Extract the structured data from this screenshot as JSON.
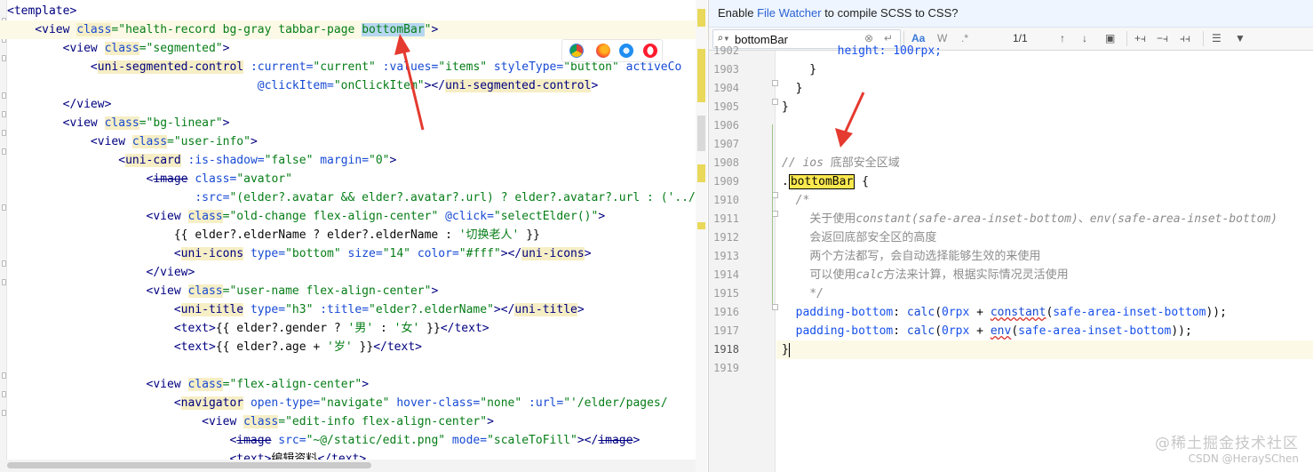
{
  "left_editor": {
    "lines": [
      {
        "segments": [
          {
            "t": "<template>",
            "c": "t-tag"
          }
        ]
      },
      {
        "segments": [
          {
            "t": "    <view ",
            "c": "t-tag"
          },
          {
            "t": "class",
            "c": "t-attr t-hl"
          },
          {
            "t": "=\"health-record bg-gray tabbar-page ",
            "c": "t-str"
          },
          {
            "t": "bottomBar",
            "c": "t-str t-sel"
          },
          {
            "t": "\"",
            "c": "t-str"
          },
          {
            "t": ">",
            "c": "t-tag"
          }
        ],
        "current": true
      },
      {
        "segments": [
          {
            "t": "        <view ",
            "c": "t-tag"
          },
          {
            "t": "class",
            "c": "t-attr t-hl"
          },
          {
            "t": "=\"segmented\"",
            "c": "t-str"
          },
          {
            "t": ">",
            "c": "t-tag"
          }
        ]
      },
      {
        "segments": [
          {
            "t": "            <",
            "c": "t-tag"
          },
          {
            "t": "uni-segmented-control",
            "c": "t-tag t-hl"
          },
          {
            "t": " :current=",
            "c": "t-attr"
          },
          {
            "t": "\"current\"",
            "c": "t-str"
          },
          {
            "t": " :values=",
            "c": "t-attr"
          },
          {
            "t": "\"items\"",
            "c": "t-str"
          },
          {
            "t": " styleType=",
            "c": "t-attr"
          },
          {
            "t": "\"button\"",
            "c": "t-str"
          },
          {
            "t": " activeCo",
            "c": "t-attr"
          }
        ]
      },
      {
        "segments": [
          {
            "t": "                                    @clickItem=",
            "c": "t-attr"
          },
          {
            "t": "\"onClickItem\"",
            "c": "t-str"
          },
          {
            "t": "></",
            "c": "t-tag"
          },
          {
            "t": "uni-segmented-control",
            "c": "t-tag t-hl"
          },
          {
            "t": ">",
            "c": "t-tag"
          }
        ]
      },
      {
        "segments": [
          {
            "t": "        </view>",
            "c": "t-tag"
          }
        ]
      },
      {
        "segments": [
          {
            "t": "        <view ",
            "c": "t-tag"
          },
          {
            "t": "class",
            "c": "t-attr t-hl"
          },
          {
            "t": "=\"bg-linear\"",
            "c": "t-str"
          },
          {
            "t": ">",
            "c": "t-tag"
          }
        ]
      },
      {
        "segments": [
          {
            "t": "            <view ",
            "c": "t-tag"
          },
          {
            "t": "class",
            "c": "t-attr t-hl"
          },
          {
            "t": "=\"user-info\"",
            "c": "t-str"
          },
          {
            "t": ">",
            "c": "t-tag"
          }
        ]
      },
      {
        "segments": [
          {
            "t": "                <",
            "c": "t-tag"
          },
          {
            "t": "uni-card",
            "c": "t-tag t-hl"
          },
          {
            "t": " :is-shadow=",
            "c": "t-attr"
          },
          {
            "t": "\"false\"",
            "c": "t-str"
          },
          {
            "t": " margin=",
            "c": "t-attr"
          },
          {
            "t": "\"0\"",
            "c": "t-str"
          },
          {
            "t": ">",
            "c": "t-tag"
          }
        ]
      },
      {
        "segments": [
          {
            "t": "                    <",
            "c": "t-tag"
          },
          {
            "t": "image",
            "c": "t-tag t-strike"
          },
          {
            "t": " class=",
            "c": "t-attr"
          },
          {
            "t": "\"avator\"",
            "c": "t-str"
          }
        ]
      },
      {
        "segments": [
          {
            "t": "                           :src=",
            "c": "t-attr"
          },
          {
            "t": "\"(elder?.avatar && elder?.avatar?.url) ? elder?.avatar?.url : ('../",
            "c": "t-str"
          }
        ]
      },
      {
        "segments": [
          {
            "t": "                    <view ",
            "c": "t-tag"
          },
          {
            "t": "class",
            "c": "t-attr t-hl"
          },
          {
            "t": "=\"old-change flex-align-center\"",
            "c": "t-str"
          },
          {
            "t": " @click=",
            "c": "t-attr"
          },
          {
            "t": "\"selectElder()\"",
            "c": "t-str"
          },
          {
            "t": ">",
            "c": "t-tag"
          }
        ]
      },
      {
        "segments": [
          {
            "t": "                        {{ elder?.elderName ? elder?.elderName : ",
            "c": "t-text"
          },
          {
            "t": "'切换老人'",
            "c": "t-str"
          },
          {
            "t": " }}",
            "c": "t-text"
          }
        ]
      },
      {
        "segments": [
          {
            "t": "                        <",
            "c": "t-tag"
          },
          {
            "t": "uni-icons",
            "c": "t-tag t-hl"
          },
          {
            "t": " type=",
            "c": "t-attr"
          },
          {
            "t": "\"bottom\"",
            "c": "t-str"
          },
          {
            "t": " size=",
            "c": "t-attr"
          },
          {
            "t": "\"14\"",
            "c": "t-str"
          },
          {
            "t": " color=",
            "c": "t-attr"
          },
          {
            "t": "\"#fff\"",
            "c": "t-str"
          },
          {
            "t": "></",
            "c": "t-tag"
          },
          {
            "t": "uni-icons",
            "c": "t-tag t-hl"
          },
          {
            "t": ">",
            "c": "t-tag"
          }
        ]
      },
      {
        "segments": [
          {
            "t": "                    </view>",
            "c": "t-tag"
          }
        ]
      },
      {
        "segments": [
          {
            "t": "                    <view ",
            "c": "t-tag"
          },
          {
            "t": "class",
            "c": "t-attr t-hl"
          },
          {
            "t": "=\"user-name flex-align-center\"",
            "c": "t-str"
          },
          {
            "t": ">",
            "c": "t-tag"
          }
        ]
      },
      {
        "segments": [
          {
            "t": "                        <",
            "c": "t-tag"
          },
          {
            "t": "uni-title",
            "c": "t-tag t-hl"
          },
          {
            "t": " type=",
            "c": "t-attr"
          },
          {
            "t": "\"h3\"",
            "c": "t-str"
          },
          {
            "t": " :title=",
            "c": "t-attr"
          },
          {
            "t": "\"elder?.elderName\"",
            "c": "t-str"
          },
          {
            "t": "></",
            "c": "t-tag"
          },
          {
            "t": "uni-title",
            "c": "t-tag t-hl"
          },
          {
            "t": ">",
            "c": "t-tag"
          }
        ]
      },
      {
        "segments": [
          {
            "t": "                        <text>",
            "c": "t-tag"
          },
          {
            "t": "{{ elder?.gender ? ",
            "c": "t-text"
          },
          {
            "t": "'男'",
            "c": "t-str"
          },
          {
            "t": " : ",
            "c": "t-text"
          },
          {
            "t": "'女'",
            "c": "t-str"
          },
          {
            "t": " }}",
            "c": "t-text"
          },
          {
            "t": "</text>",
            "c": "t-tag"
          }
        ]
      },
      {
        "segments": [
          {
            "t": "                        <text>",
            "c": "t-tag"
          },
          {
            "t": "{{ elder?.age + ",
            "c": "t-text"
          },
          {
            "t": "'岁'",
            "c": "t-str"
          },
          {
            "t": " }}",
            "c": "t-text"
          },
          {
            "t": "</text>",
            "c": "t-tag"
          }
        ]
      },
      {
        "segments": [
          {
            "t": "",
            "c": "t-text"
          }
        ]
      },
      {
        "segments": [
          {
            "t": "                    <view ",
            "c": "t-tag"
          },
          {
            "t": "class",
            "c": "t-attr t-hl"
          },
          {
            "t": "=\"flex-align-center\"",
            "c": "t-str"
          },
          {
            "t": ">",
            "c": "t-tag"
          }
        ]
      },
      {
        "segments": [
          {
            "t": "                        <",
            "c": "t-tag"
          },
          {
            "t": "navigator",
            "c": "t-tag t-hl"
          },
          {
            "t": " open-type=",
            "c": "t-attr"
          },
          {
            "t": "\"navigate\"",
            "c": "t-str"
          },
          {
            "t": " hover-class=",
            "c": "t-attr"
          },
          {
            "t": "\"none\"",
            "c": "t-str"
          },
          {
            "t": " :url=",
            "c": "t-attr"
          },
          {
            "t": "\"'/elder/pages/",
            "c": "t-str"
          }
        ]
      },
      {
        "segments": [
          {
            "t": "                            <view ",
            "c": "t-tag"
          },
          {
            "t": "class",
            "c": "t-attr t-hl"
          },
          {
            "t": "=\"edit-info flex-align-center\"",
            "c": "t-str"
          },
          {
            "t": ">",
            "c": "t-tag"
          }
        ]
      },
      {
        "segments": [
          {
            "t": "                                <",
            "c": "t-tag"
          },
          {
            "t": "image",
            "c": "t-tag t-strike"
          },
          {
            "t": " src=",
            "c": "t-attr"
          },
          {
            "t": "\"~@/static/edit.png\"",
            "c": "t-str"
          },
          {
            "t": " mode=",
            "c": "t-attr"
          },
          {
            "t": "\"scaleToFill\"",
            "c": "t-str"
          },
          {
            "t": "></",
            "c": "t-tag"
          },
          {
            "t": "image",
            "c": "t-tag t-strike"
          },
          {
            "t": ">",
            "c": "t-tag"
          }
        ]
      },
      {
        "segments": [
          {
            "t": "                                <text>",
            "c": "t-tag"
          },
          {
            "t": "编辑资料",
            "c": "t-text"
          },
          {
            "t": "</text>",
            "c": "t-tag"
          }
        ]
      }
    ]
  },
  "banner": {
    "prefix": "Enable ",
    "link": "File Watcher",
    "suffix": " to compile SCSS to CSS?"
  },
  "search": {
    "value": "bottomBar",
    "match_case": "Aa",
    "words": "W",
    "regex": ".*",
    "count": "1/1"
  },
  "right_editor": {
    "line_numbers": [
      "1902",
      "1903",
      "1904",
      "1905",
      "1906",
      "1907",
      "1908",
      "1909",
      "1910",
      "1911",
      "1912",
      "1913",
      "1914",
      "1915",
      "1916",
      "1917",
      "1918",
      "1919"
    ],
    "lines": [
      {
        "segments": [
          {
            "t": "        height: 100rpx;",
            "c": "t-prop"
          }
        ]
      },
      {
        "segments": [
          {
            "t": "    }",
            "c": "t-text"
          }
        ]
      },
      {
        "segments": [
          {
            "t": "  }",
            "c": "t-text"
          }
        ]
      },
      {
        "segments": [
          {
            "t": "}",
            "c": "t-text"
          }
        ]
      },
      {
        "segments": [
          {
            "t": "",
            "c": "t-text"
          }
        ]
      },
      {
        "segments": [
          {
            "t": "",
            "c": "t-text"
          }
        ]
      },
      {
        "segments": [
          {
            "t": "// ios ",
            "c": "t-comment"
          },
          {
            "t": "底部安全区域",
            "c": "t-comment cjk"
          }
        ]
      },
      {
        "segments": [
          {
            "t": ".",
            "c": "t-text"
          },
          {
            "t": "bottomBar",
            "c": "t-text t-sel-yellow"
          },
          {
            "t": " {",
            "c": "t-text"
          }
        ]
      },
      {
        "segments": [
          {
            "t": "  /*",
            "c": "t-comment"
          }
        ]
      },
      {
        "segments": [
          {
            "t": "    ",
            "c": "t-comment"
          },
          {
            "t": "关于使用",
            "c": "t-comment cjk"
          },
          {
            "t": "constant(safe-area-inset-bottom)",
            "c": "t-comment"
          },
          {
            "t": "、",
            "c": "t-comment cjk"
          },
          {
            "t": "env(safe-area-inset-bottom)",
            "c": "t-comment"
          }
        ]
      },
      {
        "segments": [
          {
            "t": "    ",
            "c": "t-comment"
          },
          {
            "t": "会返回底部安全区的高度",
            "c": "t-comment cjk"
          }
        ]
      },
      {
        "segments": [
          {
            "t": "    ",
            "c": "t-comment"
          },
          {
            "t": "两个方法都写，会自动选择能够生效的来使用",
            "c": "t-comment cjk"
          }
        ]
      },
      {
        "segments": [
          {
            "t": "    ",
            "c": "t-comment"
          },
          {
            "t": "可以使用",
            "c": "t-comment cjk"
          },
          {
            "t": "calc",
            "c": "t-comment"
          },
          {
            "t": "方法来计算，根据实际情况灵活使用",
            "c": "t-comment cjk"
          }
        ]
      },
      {
        "segments": [
          {
            "t": "    */",
            "c": "t-comment"
          }
        ]
      },
      {
        "segments": [
          {
            "t": "  padding-bottom",
            "c": "t-prop"
          },
          {
            "t": ": ",
            "c": "t-text"
          },
          {
            "t": "calc",
            "c": "t-fn"
          },
          {
            "t": "(",
            "c": "t-text"
          },
          {
            "t": "0rpx",
            "c": "t-num"
          },
          {
            "t": " + ",
            "c": "t-text"
          },
          {
            "t": "constant",
            "c": "t-fn underline-red"
          },
          {
            "t": "(",
            "c": "t-text"
          },
          {
            "t": "safe-area-inset-bottom",
            "c": "t-prop"
          },
          {
            "t": "));",
            "c": "t-text"
          }
        ]
      },
      {
        "segments": [
          {
            "t": "  padding-bottom",
            "c": "t-prop"
          },
          {
            "t": ": ",
            "c": "t-text"
          },
          {
            "t": "calc",
            "c": "t-fn"
          },
          {
            "t": "(",
            "c": "t-text"
          },
          {
            "t": "0rpx",
            "c": "t-num"
          },
          {
            "t": " + ",
            "c": "t-text"
          },
          {
            "t": "env",
            "c": "t-fn underline-red"
          },
          {
            "t": "(",
            "c": "t-text"
          },
          {
            "t": "safe-area-inset-bottom",
            "c": "t-prop"
          },
          {
            "t": "));",
            "c": "t-text"
          }
        ]
      },
      {
        "segments": [
          {
            "t": "}",
            "c": "t-text"
          }
        ],
        "current": true
      },
      {
        "segments": [
          {
            "t": "",
            "c": "t-text"
          }
        ]
      }
    ]
  },
  "watermark": {
    "main": "@稀土掘金技术社区",
    "sub": "CSDN @HeraySChen"
  },
  "colors": {
    "arrow": "#e53a2f",
    "selection": "#b7d6f0",
    "search_highlight": "#fce94f"
  }
}
